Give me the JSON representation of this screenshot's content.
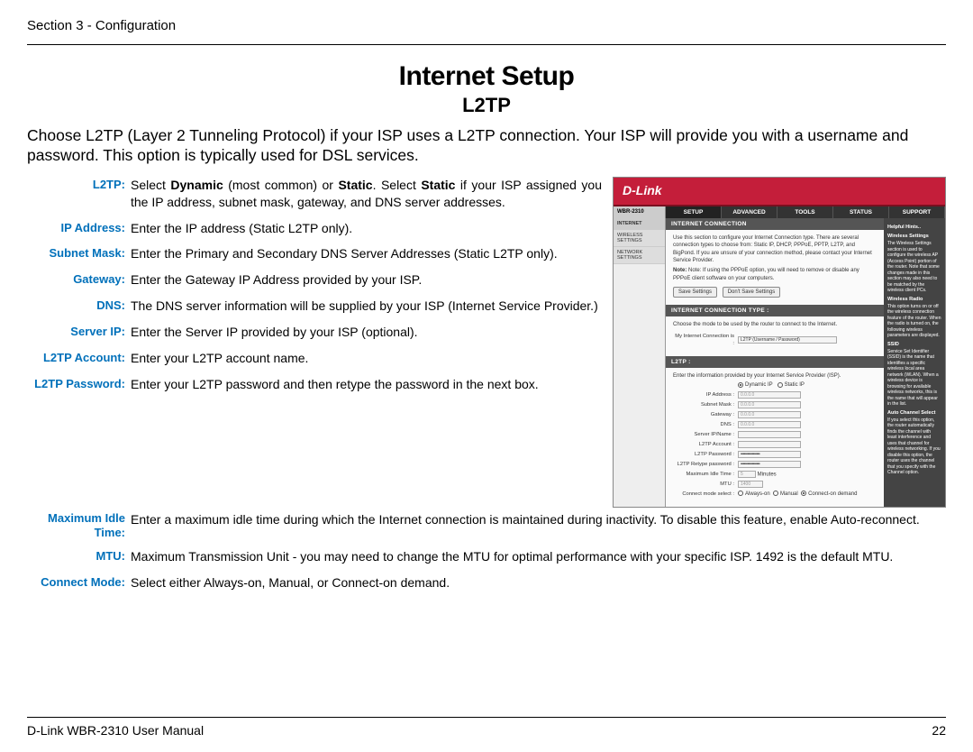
{
  "header": {
    "section": "Section 3 - Configuration"
  },
  "title": "Internet Setup",
  "subtitle": "L2TP",
  "intro": "Choose L2TP (Layer 2 Tunneling Protocol) if your ISP uses a L2TP connection. Your ISP will provide you with a username and password. This option is typically used for DSL services.",
  "defs": [
    {
      "label": "L2TP:",
      "text": "Select <b>Dynamic</b> (most common) or <b>Static</b>. Select <b>Static</b> if your ISP assigned you the IP address, subnet mask, gateway, and DNS server addresses."
    },
    {
      "label": "IP Address:",
      "text": "Enter the IP address (Static L2TP only)."
    },
    {
      "label": "Subnet Mask:",
      "text": "Enter the Primary and Secondary DNS Server Addresses (Static L2TP only)."
    },
    {
      "label": "Gateway:",
      "text": "Enter the Gateway IP Address provided by your ISP."
    },
    {
      "label": "DNS:",
      "text": "The DNS server information will be supplied by your ISP (Internet Service Provider.)"
    },
    {
      "label": "Server IP:",
      "text": "Enter the Server IP provided by your ISP (optional)."
    },
    {
      "label": "L2TP Account:",
      "text": "Enter your L2TP account name."
    },
    {
      "label": "L2TP Password:",
      "text": "Enter your L2TP password and then retype the password in the next box."
    }
  ],
  "defs_wide": [
    {
      "label": "Maximum Idle Time:",
      "text": "Enter a maximum idle time during which the Internet connection is maintained during inactivity. To disable this feature, enable Auto-reconnect."
    },
    {
      "label": "MTU:",
      "text": "Maximum Transmission Unit - you may need to change the MTU for optimal performance with your specific ISP. 1492 is the default MTU."
    },
    {
      "label": "Connect Mode:",
      "text": "Select either Always-on, Manual, or Connect-on demand."
    }
  ],
  "screenshot": {
    "brand": "D-Link",
    "model": "WBR-2310",
    "tabs": [
      "SETUP",
      "ADVANCED",
      "TOOLS",
      "STATUS",
      "SUPPORT"
    ],
    "side": [
      "INTERNET",
      "WIRELESS SETTINGS",
      "NETWORK SETTINGS"
    ],
    "panels": {
      "conn_h": "INTERNET CONNECTION",
      "conn_body": "Use this section to configure your Internet Connection type. There are several connection types to choose from: Static IP, DHCP, PPPoE, PPTP, L2TP, and BigPond. If you are unsure of your connection method, please contact your Internet Service Provider.",
      "conn_note": "Note: If using the PPPoE option, you will need to remove or disable any PPPoE client software on your computers.",
      "btn_save": "Save Settings",
      "btn_cancel": "Don't Save Settings",
      "type_h": "INTERNET CONNECTION TYPE :",
      "type_body": "Choose the mode to be used by the router to connect to the Internet.",
      "type_label": "My Internet Connection is :",
      "type_value": "L2TP (Username / Password)",
      "l2tp_h": "L2TP :",
      "l2tp_body": "Enter the information provided by your Internet Service Provider (ISP).",
      "ip_mode": {
        "dyn": "Dynamic IP",
        "stat": "Static IP"
      },
      "rows": {
        "ip": {
          "label": "IP Address :",
          "val": "0.0.0.0"
        },
        "mask": {
          "label": "Subnet Mask :",
          "val": "0.0.0.0"
        },
        "gw": {
          "label": "Gateway :",
          "val": "0.0.0.0"
        },
        "dns": {
          "label": "DNS :",
          "val": "0.0.0.0"
        },
        "srv": {
          "label": "Server IP/Name :",
          "val": ""
        },
        "acct": {
          "label": "L2TP Account :",
          "val": ""
        },
        "pwd": {
          "label": "L2TP Password :",
          "val": ""
        },
        "pwd2": {
          "label": "L2TP Retype password :",
          "val": ""
        },
        "idle": {
          "label": "Maximum Idle Time :",
          "val": "5",
          "unit": "Minutes"
        },
        "mtu": {
          "label": "MTU :",
          "val": "1400"
        },
        "mode": {
          "label": "Connect mode select :",
          "a": "Always-on",
          "b": "Manual",
          "c": "Connect-on demand"
        }
      }
    },
    "hints": {
      "title": "Helpful Hints..",
      "w1h": "Wireless Settings",
      "w1": "The Wireless Settings section is used to configure the wireless AP (Access Point) portion of the router. Note that some changes made in this section may also need to be matched by the wireless client PCs.",
      "w2h": "Wireless Radio",
      "w2": "This option turns on or off the wireless connection feature of the router. When the radio is turned on, the following wireless parameters are displayed.",
      "w3h": "SSID",
      "w3": "Service Set Identifier (SSID) is the name that identifies a specific wireless local area network (WLAN). When a wireless device is browsing for available wireless networks, this is the name that will appear in the list.",
      "w4h": "Auto Channel Select",
      "w4": "If you select this option, the router automatically finds the channel with least interference and uses that channel for wireless networking. If you disable this option, the router uses the channel that you specify with the Channel option."
    }
  },
  "footer": {
    "left": "D-Link WBR-2310 User Manual",
    "right": "22"
  }
}
